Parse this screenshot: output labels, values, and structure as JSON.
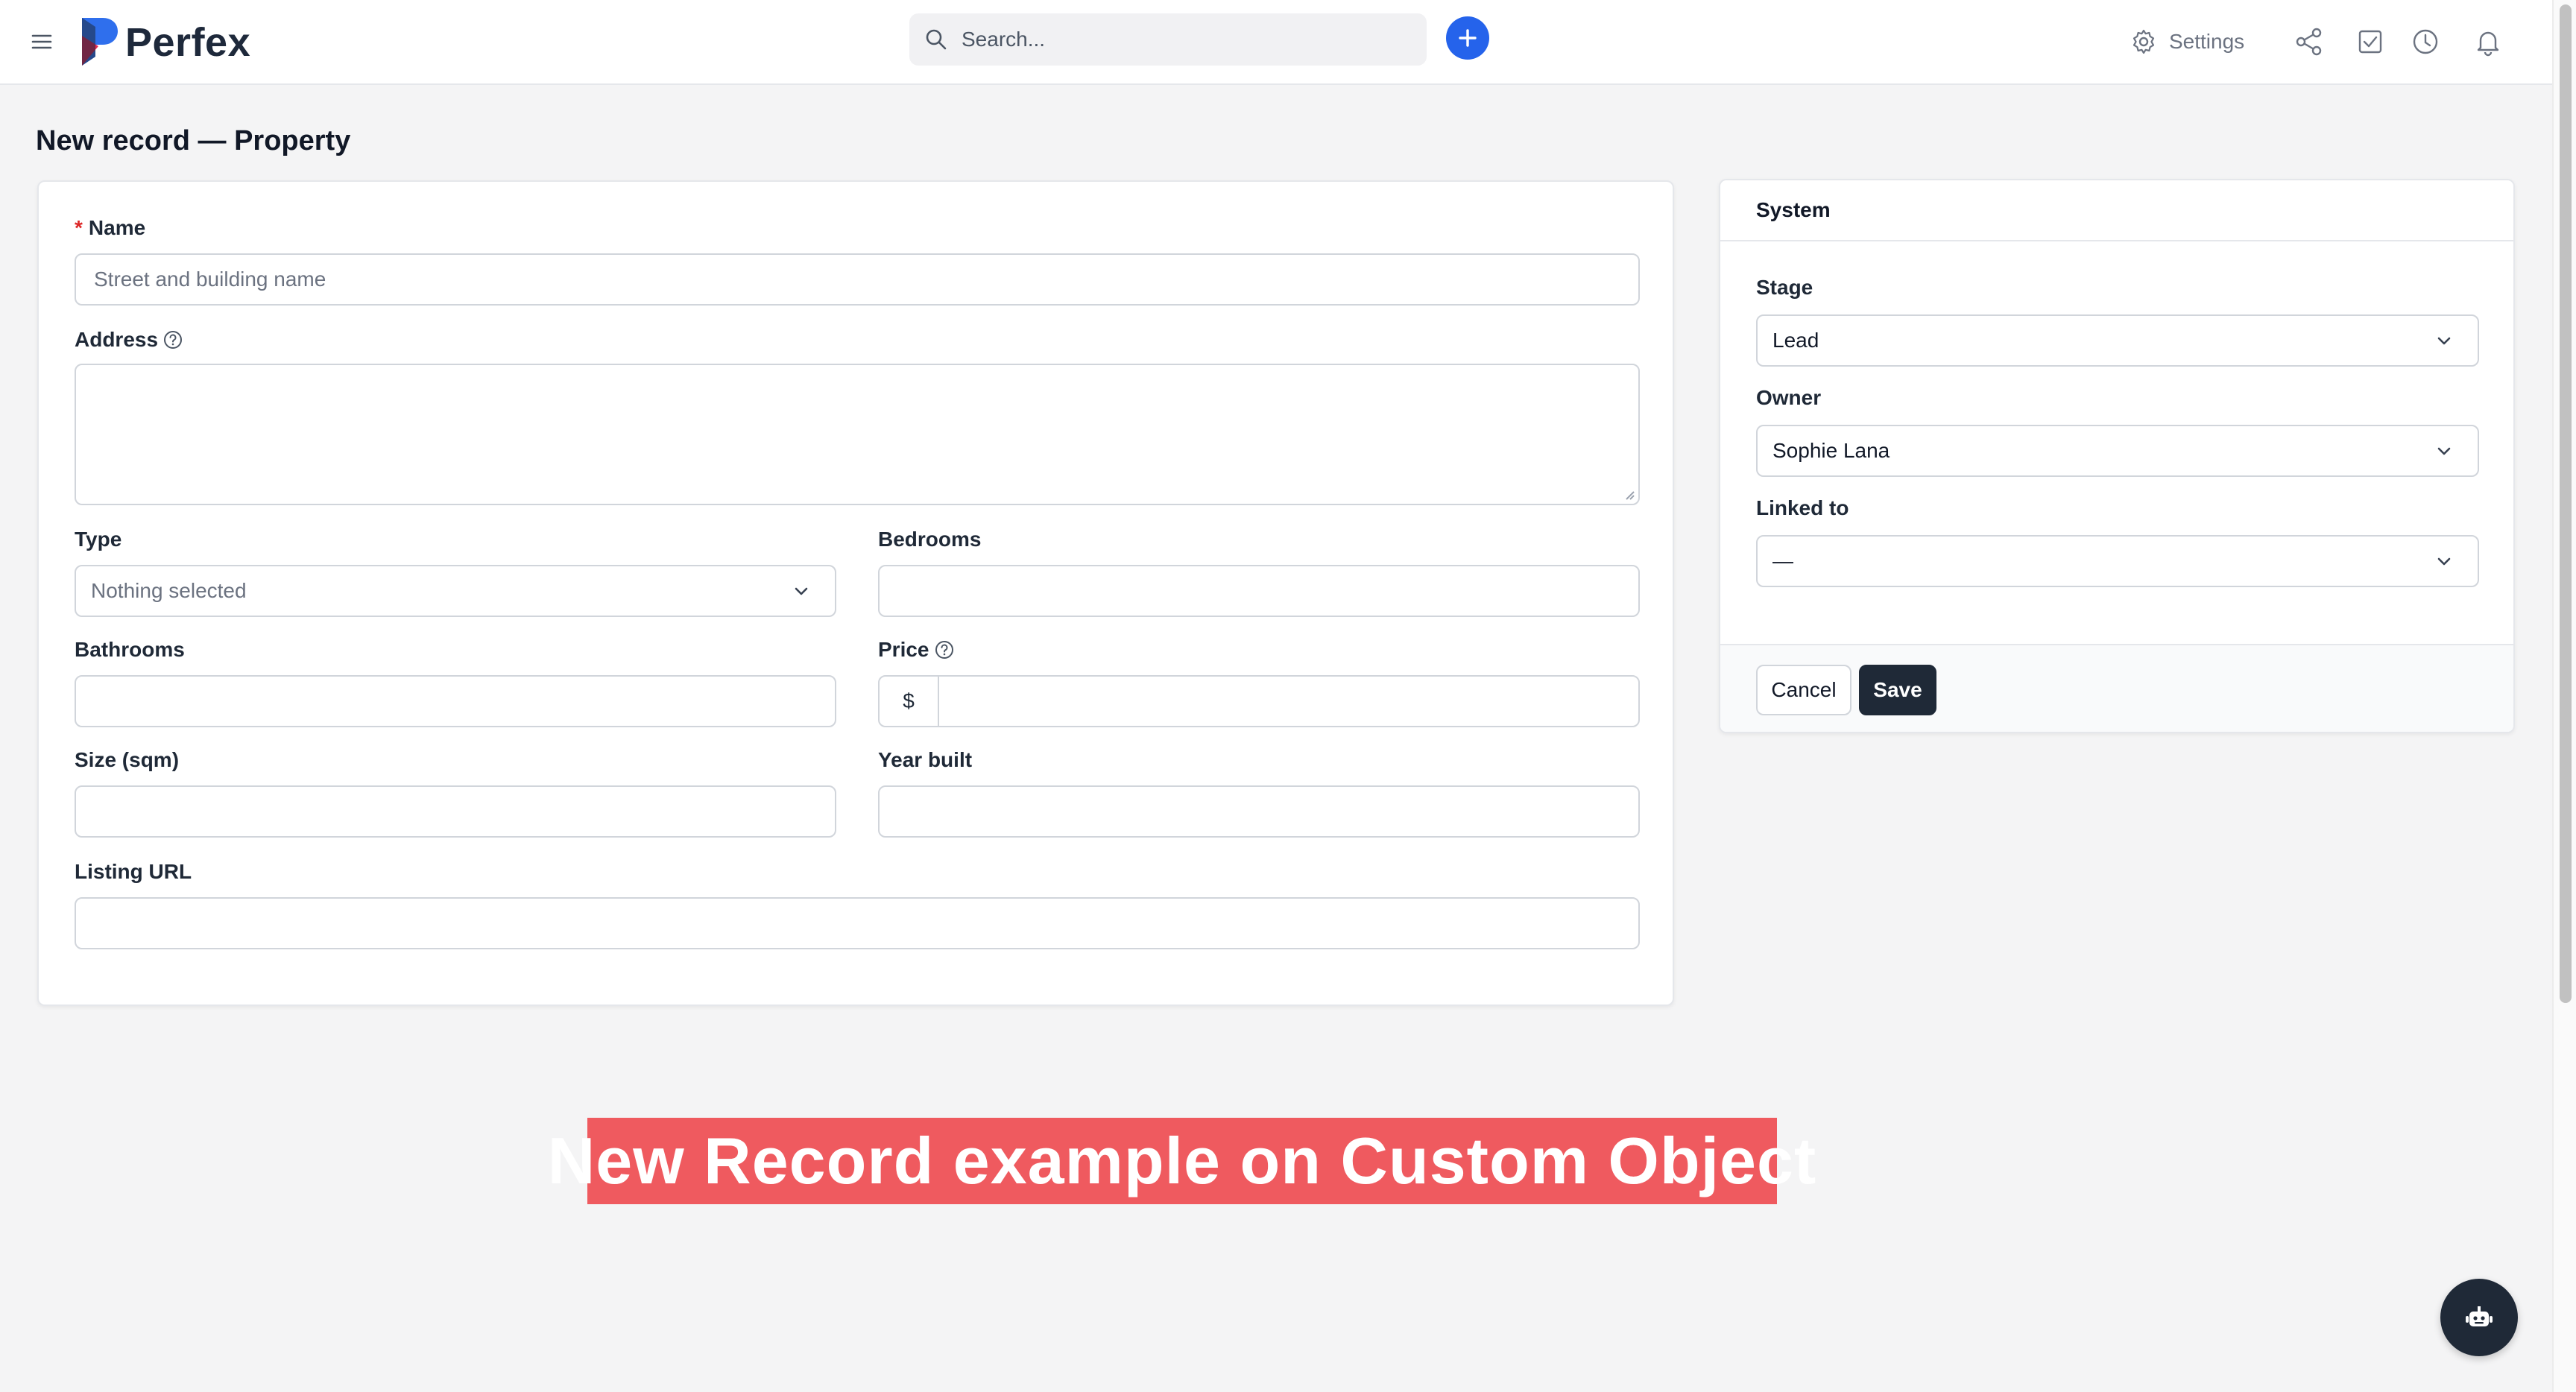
{
  "header": {
    "brand": "Perfex",
    "search_placeholder": "Search...",
    "settings_label": "Settings",
    "icons": [
      "menu-icon",
      "search-icon",
      "plus-icon",
      "gear-icon",
      "share-icon",
      "checkbox-icon",
      "clock-icon",
      "bell-icon"
    ]
  },
  "page": {
    "title": "New record — Property"
  },
  "form": {
    "name": {
      "label": "Name",
      "required_mark": "*",
      "placeholder": "Street and building name"
    },
    "address": {
      "label": "Address"
    },
    "type": {
      "label": "Type",
      "selected": "Nothing selected"
    },
    "bedrooms": {
      "label": "Bedrooms"
    },
    "bathrooms": {
      "label": "Bathrooms"
    },
    "price": {
      "label": "Price",
      "prefix": "$"
    },
    "size": {
      "label": "Size (sqm)"
    },
    "year_built": {
      "label": "Year built"
    },
    "listing_url": {
      "label": "Listing URL"
    }
  },
  "system": {
    "title": "System",
    "stage": {
      "label": "Stage",
      "selected": "Lead"
    },
    "owner": {
      "label": "Owner",
      "selected": "Sophie Lana"
    },
    "linked_to": {
      "label": "Linked to",
      "selected": "—"
    },
    "cancel_label": "Cancel",
    "save_label": "Save"
  },
  "banner": {
    "text": "New Record example on Custom Object"
  },
  "colors": {
    "accent": "#2563eb",
    "banner": "#ef5a5f",
    "dark_button": "#1f2937",
    "required": "#dc2626"
  }
}
